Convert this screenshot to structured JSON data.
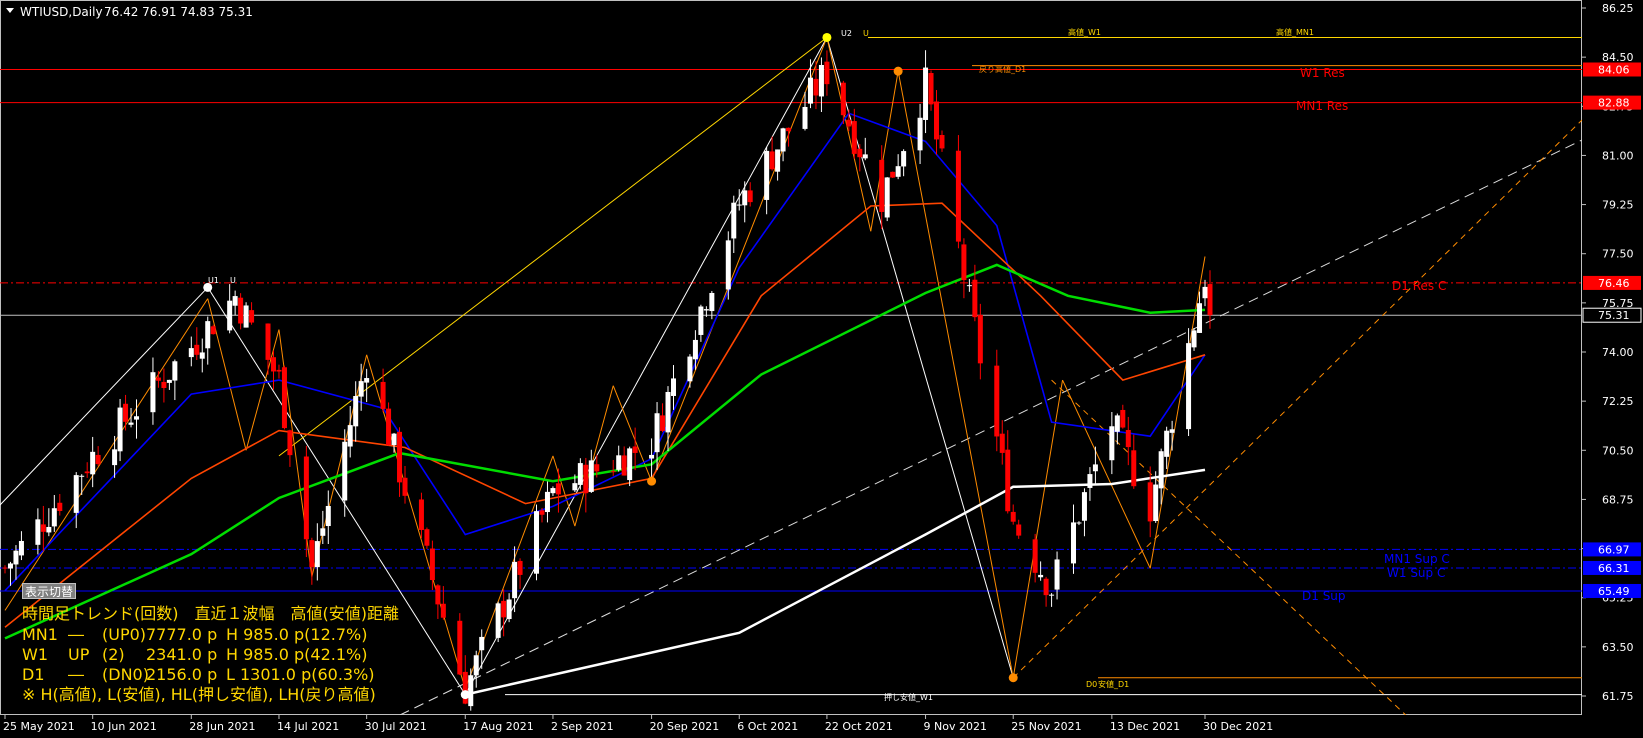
{
  "header": {
    "symbol": "WTIUSD,Daily",
    "ohlc": "76.42 76.91 74.83 75.31"
  },
  "toggle_button": {
    "label": "表示切替"
  },
  "price_axis": {
    "ticks": [
      "86.25",
      "84.50",
      "82.75",
      "81.00",
      "79.25",
      "77.50",
      "75.75",
      "74.00",
      "72.25",
      "70.50",
      "68.75",
      "67.00",
      "65.25",
      "63.50",
      "61.75"
    ],
    "current_price": "75.31"
  },
  "time_axis": {
    "labels": [
      "25 May 2021",
      "10 Jun 2021",
      "28 Jun 2021",
      "14 Jul 2021",
      "30 Jul 2021",
      "17 Aug 2021",
      "2 Sep 2021",
      "20 Sep 2021",
      "6 Oct 2021",
      "22 Oct 2021",
      "9 Nov 2021",
      "25 Nov 2021",
      "13 Dec 2021",
      "30 Dec 2021"
    ]
  },
  "levels": [
    {
      "name": "W1 Res",
      "price": "84.06",
      "color": "#ff0000",
      "style": "solid",
      "label": "W1 Res"
    },
    {
      "name": "MN1 Res",
      "price": "82.88",
      "color": "#ff0000",
      "style": "solid",
      "label": "MN1 Res"
    },
    {
      "name": "D1 Res C",
      "price": "76.46",
      "color": "#ff0000",
      "style": "dashdot",
      "label": "D1 Res C"
    },
    {
      "name": "MN1 Sup C",
      "price": "66.97",
      "color": "#0000ff",
      "style": "dashdot",
      "label": "MN1 Sup C"
    },
    {
      "name": "W1 Sup C",
      "price": "66.31",
      "color": "#0000ff",
      "style": "dashdot",
      "label": "W1 Sup C"
    },
    {
      "name": "D1 Sup",
      "price": "65.49",
      "color": "#0000ff",
      "style": "solid",
      "label": "D1 Sup"
    }
  ],
  "marker_labels": {
    "top_left": "U2",
    "top_right": "U",
    "high_w1": "高値_W1",
    "high_mn1": "高値_MN1",
    "pullback_high_d1": "戻り高値_D1",
    "u1_left": "U1",
    "u1_right": "U",
    "low_d1_left": "D0",
    "low_d1_right": "安値_D1",
    "pullback_low_w1": "押し安値_W1"
  },
  "info_panel": {
    "header": "時間足トレンド(回数)　直近１波幅　高値(安値)距離",
    "rows": [
      {
        "tf": "MN1",
        "dir": "―",
        "count": "(UP0)",
        "wave": "7777.0 p",
        "dist": "H 985.0 p(12.7%)"
      },
      {
        "tf": "W1",
        "dir": "UP",
        "count": "(2)",
        "wave": "2341.0 p",
        "dist": "H 985.0 p(42.1%)"
      },
      {
        "tf": "D1",
        "dir": "―",
        "count": "(DN0)",
        "wave": "2156.0 p",
        "dist": "L 1301.0 p(60.3%)"
      }
    ],
    "footnote": "※ H(高値), L(安値), HL(押し安値), LH(戻り高値)"
  },
  "chart_data": {
    "type": "candlestick",
    "title": "WTIUSD,Daily",
    "ylim": [
      61.2,
      86.6
    ],
    "last": {
      "open": 76.42,
      "high": 76.91,
      "low": 74.83,
      "close": 75.31
    },
    "price_anchors": [
      {
        "date": "25 May 2021",
        "close": 66.3
      },
      {
        "date": "10 Jun 2021",
        "close": 70.3
      },
      {
        "date": "28 Jun 2021",
        "close": 74.2
      },
      {
        "date": "6 Jul 2021",
        "close": 76.0
      },
      {
        "date": "14 Jul 2021",
        "close": 73.0
      },
      {
        "date": "20 Jul 2021",
        "close": 66.3
      },
      {
        "date": "30 Jul 2021",
        "close": 73.7
      },
      {
        "date": "17 Aug 2021",
        "close": 62.0
      },
      {
        "date": "2 Sep 2021",
        "close": 69.0
      },
      {
        "date": "20 Sep 2021",
        "close": 70.8
      },
      {
        "date": "6 Oct 2021",
        "close": 79.3
      },
      {
        "date": "22 Oct 2021",
        "close": 84.0
      },
      {
        "date": "1 Nov 2021",
        "close": 79.5
      },
      {
        "date": "9 Nov 2021",
        "close": 83.5
      },
      {
        "date": "25 Nov 2021",
        "close": 68.0
      },
      {
        "date": "2 Dec 2021",
        "close": 65.6
      },
      {
        "date": "13 Dec 2021",
        "close": 71.5
      },
      {
        "date": "20 Dec 2021",
        "close": 68.5
      },
      {
        "date": "30 Dec 2021",
        "close": 76.7
      }
    ],
    "colors": {
      "up": "#ffffff",
      "down": "#ff0000"
    },
    "moving_averages": [
      {
        "color": "#0000ff",
        "anchors": [
          {
            "date": "25 May 2021",
            "v": 65.5
          },
          {
            "date": "28 Jun 2021",
            "v": 72.5
          },
          {
            "date": "14 Jul 2021",
            "v": 73.0
          },
          {
            "date": "2 Aug 2021",
            "v": 72.0
          },
          {
            "date": "17 Aug 2021",
            "v": 67.5
          },
          {
            "date": "2 Sep 2021",
            "v": 68.5
          },
          {
            "date": "20 Sep 2021",
            "v": 70.2
          },
          {
            "date": "6 Oct 2021",
            "v": 77.0
          },
          {
            "date": "26 Oct 2021",
            "v": 82.5
          },
          {
            "date": "9 Nov 2021",
            "v": 81.5
          },
          {
            "date": "22 Nov 2021",
            "v": 78.5
          },
          {
            "date": "2 Dec 2021",
            "v": 71.5
          },
          {
            "date": "20 Dec 2021",
            "v": 71.0
          },
          {
            "date": "30 Dec 2021",
            "v": 73.9
          }
        ]
      },
      {
        "color": "#ff4500",
        "anchors": [
          {
            "date": "25 May 2021",
            "v": 64.2
          },
          {
            "date": "28 Jun 2021",
            "v": 69.5
          },
          {
            "date": "14 Jul 2021",
            "v": 71.2
          },
          {
            "date": "6 Aug 2021",
            "v": 70.6
          },
          {
            "date": "28 Aug 2021",
            "v": 68.6
          },
          {
            "date": "20 Sep 2021",
            "v": 69.5
          },
          {
            "date": "10 Oct 2021",
            "v": 76.0
          },
          {
            "date": "30 Oct 2021",
            "v": 79.2
          },
          {
            "date": "12 Nov 2021",
            "v": 79.3
          },
          {
            "date": "30 Nov 2021",
            "v": 76.0
          },
          {
            "date": "15 Dec 2021",
            "v": 73.0
          },
          {
            "date": "30 Dec 2021",
            "v": 73.9
          }
        ]
      },
      {
        "color": "#00dd00",
        "anchors": [
          {
            "date": "25 May 2021",
            "v": 63.8
          },
          {
            "date": "28 Jun 2021",
            "v": 66.8
          },
          {
            "date": "14 Jul 2021",
            "v": 68.8
          },
          {
            "date": "5 Aug 2021",
            "v": 70.4
          },
          {
            "date": "2 Sep 2021",
            "v": 69.4
          },
          {
            "date": "20 Sep 2021",
            "v": 70.0
          },
          {
            "date": "10 Oct 2021",
            "v": 73.2
          },
          {
            "date": "9 Nov 2021",
            "v": 76.1
          },
          {
            "date": "22 Nov 2021",
            "v": 77.1
          },
          {
            "date": "5 Dec 2021",
            "v": 76.0
          },
          {
            "date": "20 Dec 2021",
            "v": 75.4
          },
          {
            "date": "30 Dec 2021",
            "v": 75.5
          }
        ]
      },
      {
        "color": "#ffffff",
        "anchors": [
          {
            "date": "17 Aug 2021",
            "v": 61.8
          },
          {
            "date": "6 Oct 2021",
            "v": 64.0
          },
          {
            "date": "9 Nov 2021",
            "v": 67.5
          },
          {
            "date": "25 Nov 2021",
            "v": 69.2
          },
          {
            "date": "13 Dec 2021",
            "v": 69.3
          },
          {
            "date": "30 Dec 2021",
            "v": 69.8
          }
        ]
      }
    ]
  }
}
